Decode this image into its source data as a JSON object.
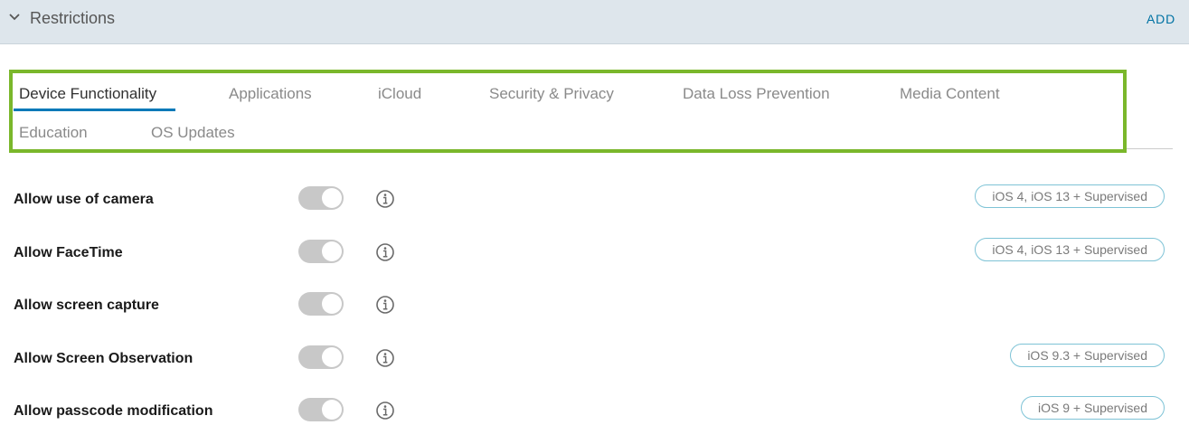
{
  "header": {
    "title": "Restrictions",
    "add_label": "ADD",
    "chevron_icon": "chevron-down-icon"
  },
  "tabs": [
    {
      "label": "Device Functionality",
      "active": true
    },
    {
      "label": "Applications",
      "active": false
    },
    {
      "label": "iCloud",
      "active": false
    },
    {
      "label": "Security & Privacy",
      "active": false
    },
    {
      "label": "Data Loss Prevention",
      "active": false
    },
    {
      "label": "Media Content",
      "active": false
    },
    {
      "label": "Education",
      "active": false
    },
    {
      "label": "OS Updates",
      "active": false
    }
  ],
  "settings": [
    {
      "label": "Allow use of camera",
      "enabled": true,
      "badge": "iOS 4, iOS 13 + Supervised"
    },
    {
      "label": "Allow FaceTime",
      "enabled": true,
      "badge": "iOS 4, iOS 13 + Supervised"
    },
    {
      "label": "Allow screen capture",
      "enabled": true,
      "badge": ""
    },
    {
      "label": "Allow Screen Observation",
      "enabled": true,
      "badge": "iOS 9.3 + Supervised"
    },
    {
      "label": "Allow passcode modification",
      "enabled": true,
      "badge": "iOS 9 + Supervised"
    }
  ],
  "colors": {
    "header_bg": "#dee6ec",
    "accent": "#0079b8",
    "highlight_box": "#7ab72b",
    "toggle_bg": "#c8c8c8",
    "badge_border": "#7ec3d6"
  }
}
